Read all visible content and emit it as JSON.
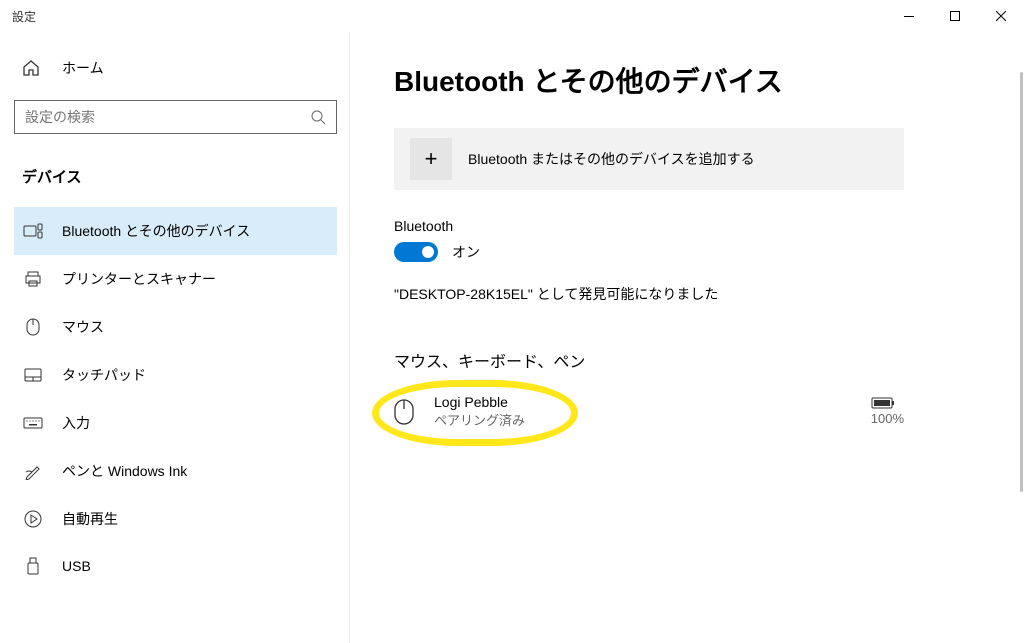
{
  "window": {
    "title": "設定"
  },
  "sidebar": {
    "home": "ホーム",
    "search_placeholder": "設定の検索",
    "category": "デバイス",
    "items": [
      {
        "label": "Bluetooth とその他のデバイス"
      },
      {
        "label": "プリンターとスキャナー"
      },
      {
        "label": "マウス"
      },
      {
        "label": "タッチパッド"
      },
      {
        "label": "入力"
      },
      {
        "label": "ペンと Windows Ink"
      },
      {
        "label": "自動再生"
      },
      {
        "label": "USB"
      }
    ]
  },
  "main": {
    "title": "Bluetooth とその他のデバイス",
    "add_device": "Bluetooth またはその他のデバイスを追加する",
    "bt_label": "Bluetooth",
    "bt_state": "オン",
    "discoverable": "\"DESKTOP-28K15EL\" として発見可能になりました",
    "device_category": "マウス、キーボード、ペン",
    "device": {
      "name": "Logi Pebble",
      "status": "ペアリング済み",
      "battery": "100%"
    }
  }
}
